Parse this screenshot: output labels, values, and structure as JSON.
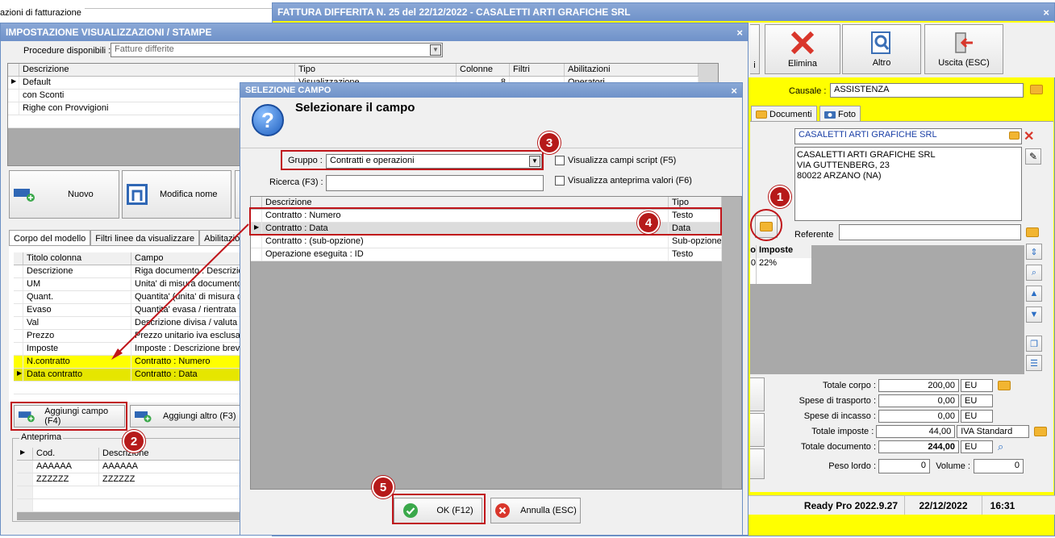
{
  "bg_window": {
    "title_partial": "azioni di fatturazione"
  },
  "invoice_window": {
    "title": "FATTURA DIFFERITA N. 25 del 22/12/2022 - CASALETTI ARTI GRAFICHE SRL",
    "close": "×",
    "toolbar": {
      "partial_label": "i",
      "delete_label": "Elimina",
      "other_label": "Altro",
      "exit_label": "Uscita (ESC)"
    },
    "causale_label": "Causale :",
    "causale_value": "ASSISTENZA",
    "tabs": {
      "documents": "Documenti",
      "photo": "Foto"
    },
    "customer_name": "CASALETTI ARTI GRAFICHE SRL",
    "address_lines": [
      "CASALETTI ARTI GRAFICHE SRL",
      "VIA GUTTENBERG, 23",
      "80022 ARZANO (NA)"
    ],
    "referente_label": "Referente",
    "lines_header": {
      "col1": "o",
      "col2": "Imposte"
    },
    "lines_row": {
      "col1": "0",
      "col2": "22%"
    },
    "totals": [
      {
        "label": "Totale corpo :",
        "value": "200,00",
        "unit": "EU"
      },
      {
        "label": "Spese di trasporto :",
        "value": "0,00",
        "unit": "EU"
      },
      {
        "label": "Spese di incasso :",
        "value": "0,00",
        "unit": "EU"
      },
      {
        "label": "Totale imposte :",
        "value": "44,00",
        "unit": "IVA Standard"
      },
      {
        "label": "Totale documento :",
        "value": "244,00",
        "unit": "EU"
      }
    ],
    "peso_label": "Peso lordo :",
    "peso_value": "0",
    "volume_label": "Volume :",
    "volume_value": "0",
    "status": {
      "version": "Ready Pro 2022.9.27",
      "date": "22/12/2022",
      "time": "16:31"
    }
  },
  "settings_window": {
    "title": "IMPOSTAZIONE VISUALIZZAZIONI / STAMPE",
    "close": "×",
    "procedure_label": "Procedure disponibili :",
    "procedure_value": "Fatture differite",
    "models_columns": [
      "Descrizione",
      "Tipo",
      "Colonne",
      "Filtri",
      "Abilitazioni"
    ],
    "models": [
      {
        "desc": "Default",
        "tipo": "Visualizzazione",
        "colonne": "8",
        "filtri": "",
        "abil": "Operatori..."
      },
      {
        "desc": "con Sconti",
        "tipo": "",
        "colonne": "",
        "filtri": "",
        "abil": ""
      },
      {
        "desc": "Righe con Provvigioni",
        "tipo": "",
        "colonne": "",
        "filtri": "",
        "abil": ""
      }
    ],
    "new_button": "Nuovo",
    "rename_button": "Modifica nome",
    "tabs": [
      "Corpo del modello",
      "Filtri linee da visualizzare",
      "Abilitazioni"
    ],
    "columns_header": [
      "Titolo colonna",
      "Campo"
    ],
    "columns": [
      {
        "title": "Descrizione",
        "field": "Riga documento : Descrizione"
      },
      {
        "title": "UM",
        "field": "Unita' di misura documento"
      },
      {
        "title": "Quant.",
        "field": "Quantita' (unita' di misura documento)"
      },
      {
        "title": "Evaso",
        "field": "Quantita' evasa / rientrata"
      },
      {
        "title": "Val",
        "field": "Descrizione divisa / valuta"
      },
      {
        "title": "Prezzo",
        "field": "Prezzo unitario iva esclusa"
      },
      {
        "title": "Imposte",
        "field": "Imposte : Descrizione breve"
      },
      {
        "title": "N.contratto",
        "field": "Contratto : Numero"
      },
      {
        "title": "Data contratto",
        "field": "Contratto : Data"
      }
    ],
    "add_field_button": "Aggiungi campo (F4)",
    "add_other_button": "Aggiungi altro (F3)",
    "preview_label": "Anteprima",
    "preview_columns": [
      "Cod.",
      "Descrizione"
    ],
    "preview_rows": [
      [
        "AAAAAA",
        "AAAAAA"
      ],
      [
        "ZZZZZZ",
        "ZZZZZZ"
      ]
    ]
  },
  "select_dialog": {
    "title": "SELEZIONE CAMPO",
    "close": "×",
    "heading": "Selezionare il campo",
    "group_label": "Gruppo :",
    "group_value": "Contratti e operazioni",
    "search_label": "Ricerca (F3) :",
    "search_value": "",
    "chk_script": "Visualizza campi script (F5)",
    "chk_preview": "Visualizza anteprima valori (F6)",
    "columns": [
      "Descrizione",
      "Tipo"
    ],
    "rows": [
      {
        "desc": "Contratto : Numero",
        "tipo": "Testo"
      },
      {
        "desc": "Contratto : Data",
        "tipo": "Data"
      },
      {
        "desc": "Contratto : (sub-opzione)",
        "tipo": "Sub-opzione"
      },
      {
        "desc": "Operazione eseguita : ID",
        "tipo": "Testo"
      }
    ],
    "ok_button": "OK (F12)",
    "cancel_button": "Annulla (ESC)"
  },
  "callouts": [
    "1",
    "2",
    "3",
    "4",
    "5"
  ],
  "colors": {
    "accent_red": "#c0151a",
    "highlight_yellow": "#ffff00",
    "title_blue": "#4a75b8"
  },
  "icons": [
    "help-icon",
    "folder-icon",
    "delete-x-icon",
    "search-icon",
    "exit-icon",
    "add-icon",
    "check-icon",
    "cancel-icon",
    "arrow-up-icon",
    "arrow-down-icon",
    "magnify-icon",
    "edit-icon",
    "camera-icon",
    "dropdown-arrow-icon"
  ]
}
